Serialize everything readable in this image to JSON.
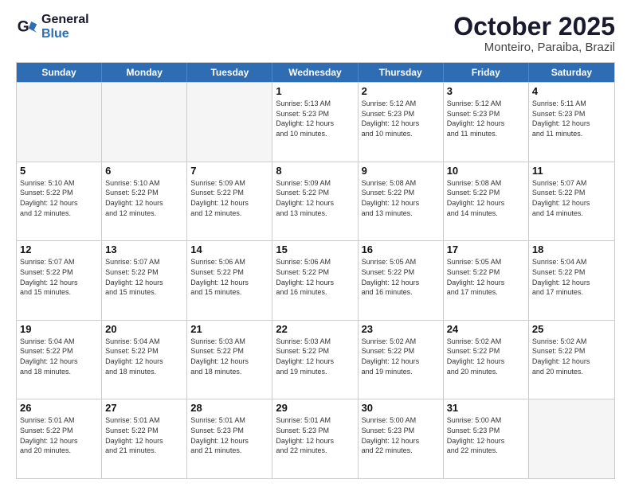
{
  "header": {
    "logo_line1": "General",
    "logo_line2": "Blue",
    "month": "October 2025",
    "location": "Monteiro, Paraiba, Brazil"
  },
  "weekdays": [
    "Sunday",
    "Monday",
    "Tuesday",
    "Wednesday",
    "Thursday",
    "Friday",
    "Saturday"
  ],
  "weeks": [
    [
      {
        "day": "",
        "info": ""
      },
      {
        "day": "",
        "info": ""
      },
      {
        "day": "",
        "info": ""
      },
      {
        "day": "1",
        "info": "Sunrise: 5:13 AM\nSunset: 5:23 PM\nDaylight: 12 hours\nand 10 minutes."
      },
      {
        "day": "2",
        "info": "Sunrise: 5:12 AM\nSunset: 5:23 PM\nDaylight: 12 hours\nand 10 minutes."
      },
      {
        "day": "3",
        "info": "Sunrise: 5:12 AM\nSunset: 5:23 PM\nDaylight: 12 hours\nand 11 minutes."
      },
      {
        "day": "4",
        "info": "Sunrise: 5:11 AM\nSunset: 5:23 PM\nDaylight: 12 hours\nand 11 minutes."
      }
    ],
    [
      {
        "day": "5",
        "info": "Sunrise: 5:10 AM\nSunset: 5:22 PM\nDaylight: 12 hours\nand 12 minutes."
      },
      {
        "day": "6",
        "info": "Sunrise: 5:10 AM\nSunset: 5:22 PM\nDaylight: 12 hours\nand 12 minutes."
      },
      {
        "day": "7",
        "info": "Sunrise: 5:09 AM\nSunset: 5:22 PM\nDaylight: 12 hours\nand 12 minutes."
      },
      {
        "day": "8",
        "info": "Sunrise: 5:09 AM\nSunset: 5:22 PM\nDaylight: 12 hours\nand 13 minutes."
      },
      {
        "day": "9",
        "info": "Sunrise: 5:08 AM\nSunset: 5:22 PM\nDaylight: 12 hours\nand 13 minutes."
      },
      {
        "day": "10",
        "info": "Sunrise: 5:08 AM\nSunset: 5:22 PM\nDaylight: 12 hours\nand 14 minutes."
      },
      {
        "day": "11",
        "info": "Sunrise: 5:07 AM\nSunset: 5:22 PM\nDaylight: 12 hours\nand 14 minutes."
      }
    ],
    [
      {
        "day": "12",
        "info": "Sunrise: 5:07 AM\nSunset: 5:22 PM\nDaylight: 12 hours\nand 15 minutes."
      },
      {
        "day": "13",
        "info": "Sunrise: 5:07 AM\nSunset: 5:22 PM\nDaylight: 12 hours\nand 15 minutes."
      },
      {
        "day": "14",
        "info": "Sunrise: 5:06 AM\nSunset: 5:22 PM\nDaylight: 12 hours\nand 15 minutes."
      },
      {
        "day": "15",
        "info": "Sunrise: 5:06 AM\nSunset: 5:22 PM\nDaylight: 12 hours\nand 16 minutes."
      },
      {
        "day": "16",
        "info": "Sunrise: 5:05 AM\nSunset: 5:22 PM\nDaylight: 12 hours\nand 16 minutes."
      },
      {
        "day": "17",
        "info": "Sunrise: 5:05 AM\nSunset: 5:22 PM\nDaylight: 12 hours\nand 17 minutes."
      },
      {
        "day": "18",
        "info": "Sunrise: 5:04 AM\nSunset: 5:22 PM\nDaylight: 12 hours\nand 17 minutes."
      }
    ],
    [
      {
        "day": "19",
        "info": "Sunrise: 5:04 AM\nSunset: 5:22 PM\nDaylight: 12 hours\nand 18 minutes."
      },
      {
        "day": "20",
        "info": "Sunrise: 5:04 AM\nSunset: 5:22 PM\nDaylight: 12 hours\nand 18 minutes."
      },
      {
        "day": "21",
        "info": "Sunrise: 5:03 AM\nSunset: 5:22 PM\nDaylight: 12 hours\nand 18 minutes."
      },
      {
        "day": "22",
        "info": "Sunrise: 5:03 AM\nSunset: 5:22 PM\nDaylight: 12 hours\nand 19 minutes."
      },
      {
        "day": "23",
        "info": "Sunrise: 5:02 AM\nSunset: 5:22 PM\nDaylight: 12 hours\nand 19 minutes."
      },
      {
        "day": "24",
        "info": "Sunrise: 5:02 AM\nSunset: 5:22 PM\nDaylight: 12 hours\nand 20 minutes."
      },
      {
        "day": "25",
        "info": "Sunrise: 5:02 AM\nSunset: 5:22 PM\nDaylight: 12 hours\nand 20 minutes."
      }
    ],
    [
      {
        "day": "26",
        "info": "Sunrise: 5:01 AM\nSunset: 5:22 PM\nDaylight: 12 hours\nand 20 minutes."
      },
      {
        "day": "27",
        "info": "Sunrise: 5:01 AM\nSunset: 5:22 PM\nDaylight: 12 hours\nand 21 minutes."
      },
      {
        "day": "28",
        "info": "Sunrise: 5:01 AM\nSunset: 5:23 PM\nDaylight: 12 hours\nand 21 minutes."
      },
      {
        "day": "29",
        "info": "Sunrise: 5:01 AM\nSunset: 5:23 PM\nDaylight: 12 hours\nand 22 minutes."
      },
      {
        "day": "30",
        "info": "Sunrise: 5:00 AM\nSunset: 5:23 PM\nDaylight: 12 hours\nand 22 minutes."
      },
      {
        "day": "31",
        "info": "Sunrise: 5:00 AM\nSunset: 5:23 PM\nDaylight: 12 hours\nand 22 minutes."
      },
      {
        "day": "",
        "info": ""
      }
    ]
  ]
}
